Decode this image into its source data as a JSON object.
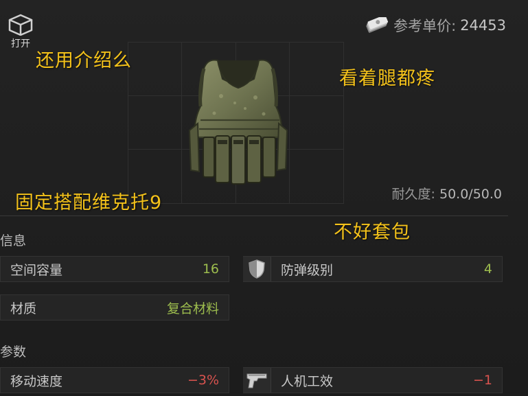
{
  "header": {
    "open_label": "打开",
    "price_label": "参考单价:",
    "price_value": "24453"
  },
  "item": {
    "icon": "armor-vest-icon",
    "durability_label": "耐久度:",
    "durability_value": "50.0/50.0"
  },
  "captions": {
    "top_left": "还用介绍么",
    "top_right": "看着腿都疼",
    "bottom_left": "固定搭配维克托9",
    "bottom_right": "不好套包"
  },
  "sections": {
    "info_title": "信息",
    "params_title": "参数"
  },
  "info": [
    {
      "name": "空间容量",
      "value": "16",
      "color": "#9dbd4e"
    },
    {
      "name": "防弹级别",
      "value": "4",
      "color": "#9dbd4e",
      "icon": "shield-icon"
    },
    {
      "name": "材质",
      "value": "复合材料",
      "color": "#9dbd4e"
    }
  ],
  "params": [
    {
      "name": "移动速度",
      "value": "−3%",
      "color": "#d9534f"
    },
    {
      "name": "人机工效",
      "value": "−1",
      "color": "#d9534f",
      "icon": "pistol-icon"
    }
  ]
}
